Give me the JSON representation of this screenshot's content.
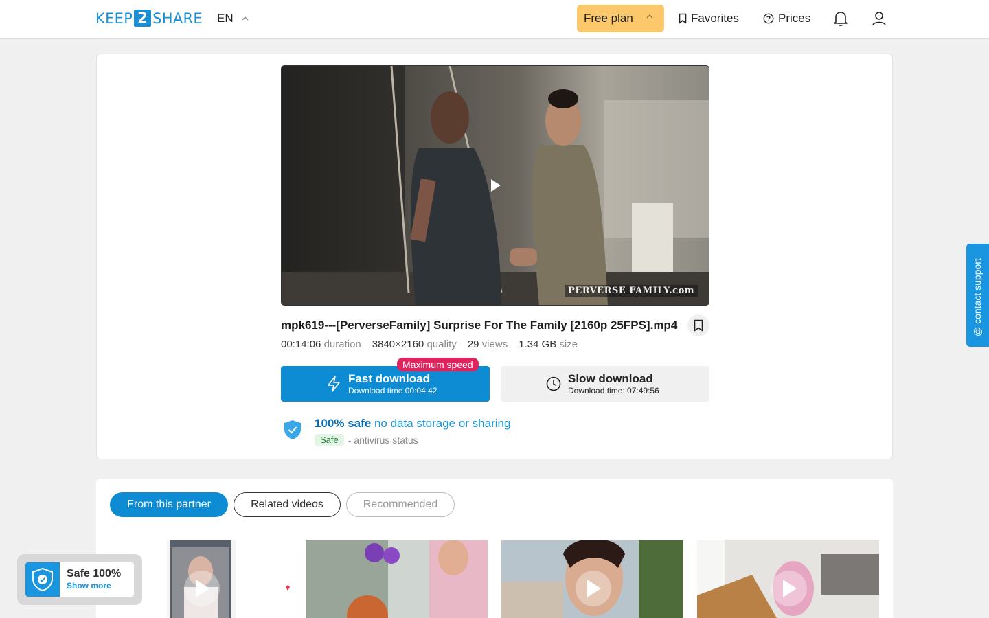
{
  "header": {
    "logo_left": "KEEP",
    "logo_mid": "2",
    "logo_right": "SHARE",
    "language": "EN",
    "plan_label": "Free plan",
    "favorites_label": "Favorites",
    "prices_label": "Prices"
  },
  "video": {
    "watermark": "PERVERSE FAMILY.com"
  },
  "file": {
    "title": "mpk619---[PerverseFamily] Surprise For The Family [2160p 25FPS].mp4",
    "meta": [
      {
        "value": "00:14:06",
        "label": "duration"
      },
      {
        "value": "3840×2160",
        "label": "quality"
      },
      {
        "value": "29",
        "label": "views"
      },
      {
        "value": "1.34 GB",
        "label": "size"
      }
    ]
  },
  "download": {
    "badge": "Maximum speed",
    "fast_title": "Fast download",
    "fast_sub": "Download time 00:04:42",
    "slow_title": "Slow download",
    "slow_sub": "Download time: 07:49:56"
  },
  "safety": {
    "strong": "100% safe",
    "light": "no data storage or sharing",
    "av_badge": "Safe",
    "av_text": "- antivirus status"
  },
  "tabs": [
    "From this partner",
    "Related videos",
    "Recommended"
  ],
  "support_label": "@ contact support",
  "safe_widget": {
    "title": "Safe 100%",
    "link": "Show more"
  },
  "colors": {
    "brand_blue": "#0d8cd4",
    "plan_yellow": "#fbc86b",
    "badge_pink": "#e0245e"
  }
}
